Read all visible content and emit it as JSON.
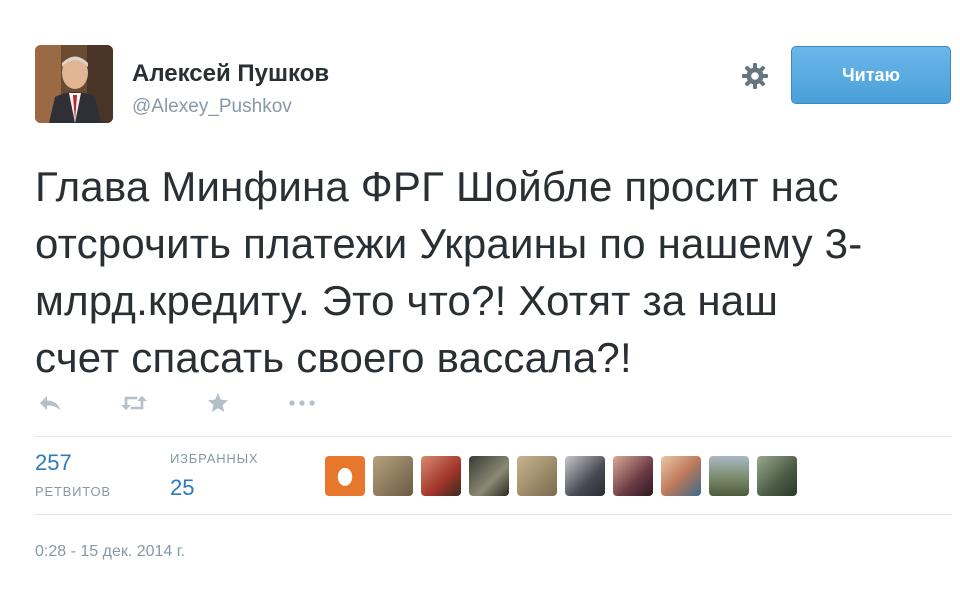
{
  "author": {
    "name": "Алексей Пушков",
    "handle": "@Alexey_Pushkov",
    "avatar_icon": "user-avatar-photo"
  },
  "header": {
    "settings_icon": "gear-icon",
    "follow_label": "Читаю",
    "accent_color": "#55acee"
  },
  "tweet": {
    "lines": [
      "Глава Минфина ФРГ Шойбле просит нас",
      "отсрочить платежи Украины по нашему 3-",
      "млрд.кредиту. Это что?! Хотят за наш",
      "счет спасать своего вассала?!"
    ]
  },
  "actions": [
    {
      "name": "reply",
      "icon": "reply-icon"
    },
    {
      "name": "retweet",
      "icon": "retweet-icon"
    },
    {
      "name": "favorite",
      "icon": "star-icon"
    },
    {
      "name": "more",
      "icon": "more-icon"
    }
  ],
  "stats": {
    "retweets_count": "257",
    "retweets_label": "РЕТВИТОВ",
    "favorites_label": "ИЗБРАННЫХ",
    "favorites_count": "25"
  },
  "favoriters": [
    {
      "icon": "egg-avatar",
      "color": "#e8772e"
    },
    {
      "icon": "user-avatar",
      "color": "#8a7a5a"
    },
    {
      "icon": "user-avatar",
      "color": "#b04a3a"
    },
    {
      "icon": "user-avatar",
      "color": "#5a5a4a"
    },
    {
      "icon": "user-avatar",
      "color": "#9a8a6a"
    },
    {
      "icon": "user-avatar",
      "color": "#4a4a55"
    },
    {
      "icon": "user-avatar",
      "color": "#7a4a55"
    },
    {
      "icon": "user-avatar",
      "color": "#c07a5a"
    },
    {
      "icon": "user-avatar",
      "color": "#7a8a6a"
    },
    {
      "icon": "user-avatar",
      "color": "#5a6a5a"
    }
  ],
  "timestamp": "0:28 - 15 дек. 2014 г."
}
